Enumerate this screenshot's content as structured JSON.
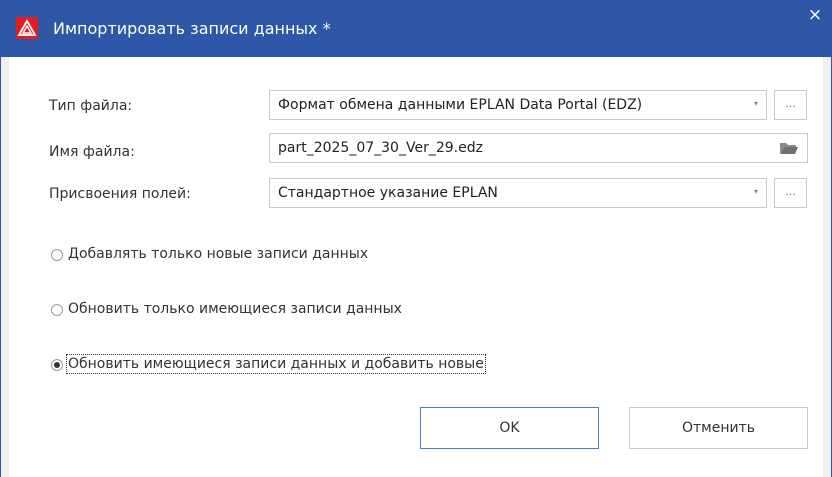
{
  "window": {
    "title": "Импортировать записи данных *",
    "close_glyph": "×",
    "app_icon": "eplan-warning-logo-icon",
    "accent_color": "#2f57a8"
  },
  "fields": {
    "file_type": {
      "label": "Тип файла:",
      "value": "Формат обмена данными EPLAN Data Portal (EDZ)",
      "button": "..."
    },
    "file_name": {
      "label": "Имя файла:",
      "value": "part_2025_07_30_Ver_29.edz",
      "icon": "folder-open-icon"
    },
    "field_assignment": {
      "label": "Присвоения полей:",
      "value": "Стандартное указание EPLAN",
      "button": "..."
    },
    "dropdown_glyph": "▾"
  },
  "options": [
    {
      "label": "Добавлять только новые записи данных",
      "checked": false
    },
    {
      "label": "Обновить только имеющиеся записи данных",
      "checked": false
    },
    {
      "label": "Обновить имеющиеся записи данных и добавить новые",
      "checked": true
    }
  ],
  "buttons": {
    "ok": "OK",
    "cancel": "Отменить"
  }
}
